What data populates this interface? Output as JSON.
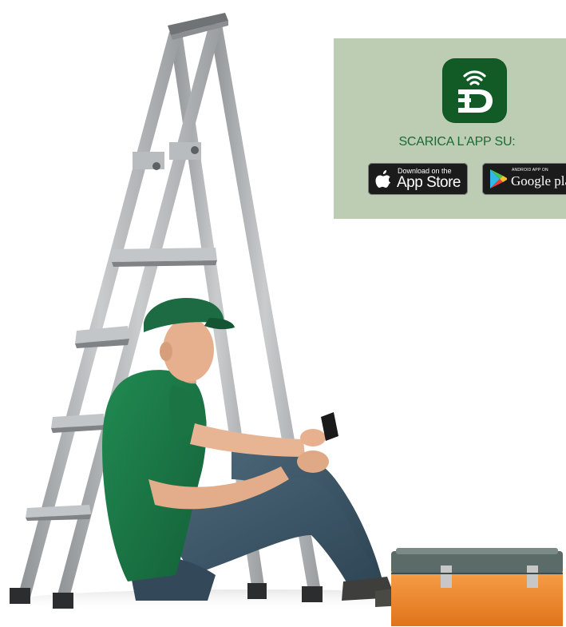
{
  "promo": {
    "background_color": "#bccdb4",
    "app_icon": {
      "name": "d-wifi-app-icon",
      "color": "#125b26"
    },
    "cta_text": "SCARICA L'APP  SU:",
    "app_store": {
      "small_text": "Download on the",
      "big_text": "App Store",
      "icon": "apple-icon"
    },
    "google_play": {
      "small_text": "ANDROID APP ON",
      "big_text": "Google play",
      "icon": "google-play-triangle-icon"
    }
  },
  "photo": {
    "subject": "repairman-with-ladder-and-toolbox",
    "cap_color": "#1c6b43",
    "shirt_color": "#1d7a48",
    "jeans_color": "#3a5568",
    "ladder_color": "#a8abae",
    "toolbox_color": "#f08a2a"
  }
}
